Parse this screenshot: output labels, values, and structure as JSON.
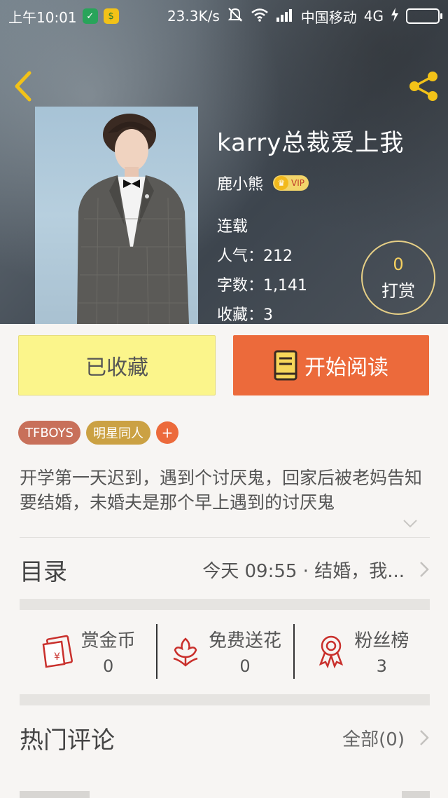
{
  "status_bar": {
    "time": "上午10:01",
    "speed": "23.3K/s",
    "carrier": "中国移动",
    "network": "4G"
  },
  "book": {
    "title": "karry总裁爱上我",
    "author": "鹿小熊",
    "vip_label": "VIP",
    "status": "连载",
    "popularity": "人气：212",
    "word_count": "字数：1,141",
    "favorites": "收藏：3"
  },
  "reward": {
    "count": "0",
    "label": "打赏"
  },
  "actions": {
    "favorited_label": "已收藏",
    "read_label": "开始阅读"
  },
  "tags": [
    "TFBOYS",
    "明星同人"
  ],
  "tag_add": "+",
  "description": "开学第一天迟到，遇到个讨厌鬼，回家后被老妈告知要结婚，未婚夫是那个早上遇到的讨厌鬼",
  "toc": {
    "title": "目录",
    "latest": "今天 09:55 · 结婚，我..."
  },
  "stats": [
    {
      "label": "赏金币",
      "value": "0",
      "icon": "red-envelope-icon"
    },
    {
      "label": "免费送花",
      "value": "0",
      "icon": "flower-icon"
    },
    {
      "label": "粉丝榜",
      "value": "3",
      "icon": "medal-icon"
    }
  ],
  "comments": {
    "title": "热门评论",
    "all_label": "全部(0)"
  },
  "colors": {
    "accent_orange": "#ec6a3b",
    "fav_yellow": "#fbf58b",
    "tag_brown": "#c8705a",
    "tag_gold": "#cba143",
    "icon_red": "#c9302c"
  }
}
